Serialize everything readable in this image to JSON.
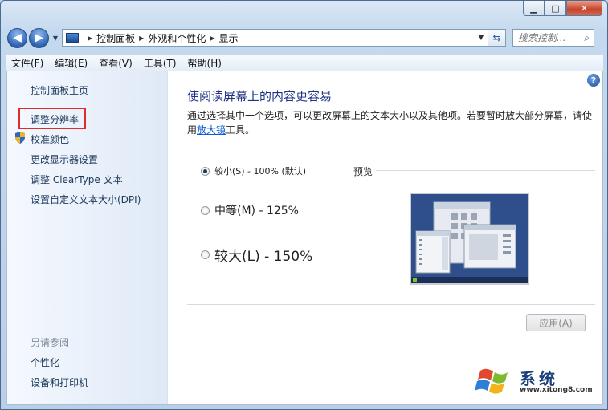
{
  "window": {
    "minimize": "▁",
    "maximize": "□",
    "close": "✕"
  },
  "nav": {
    "back": "◀",
    "forward": "▶",
    "breadcrumbs": [
      "控制面板",
      "外观和个性化",
      "显示"
    ],
    "search_placeholder": "搜索控制..."
  },
  "menu": [
    "文件(F)",
    "编辑(E)",
    "查看(V)",
    "工具(T)",
    "帮助(H)"
  ],
  "sidebar": {
    "links": [
      "控制面板主页",
      "调整分辨率",
      "校准颜色",
      "更改显示器设置",
      "调整 ClearType 文本",
      "设置自定义文本大小(DPI)"
    ],
    "see_also_heading": "另请参阅",
    "see_also": [
      "个性化",
      "设备和打印机"
    ]
  },
  "main": {
    "title": "使阅读屏幕上的内容更容易",
    "desc_before": "通过选择其中一个选项，可以更改屏幕上的文本大小以及其他项。若要暂时放大部分屏幕，请使用",
    "desc_link": "放大镜",
    "desc_after": "工具。",
    "options": [
      {
        "label": "较小(S) - 100% (默认)",
        "selected": true
      },
      {
        "label": "中等(M) - 125%",
        "selected": false
      },
      {
        "label": "较大(L) - 150%",
        "selected": false
      }
    ],
    "preview_label": "预览",
    "apply_label": "应用(A)"
  },
  "watermark": {
    "name": "系统",
    "url": "www.xitong8.com"
  },
  "colors": {
    "link": "#1e395b",
    "title": "#1e3287",
    "highlight": "#e02b2b"
  }
}
